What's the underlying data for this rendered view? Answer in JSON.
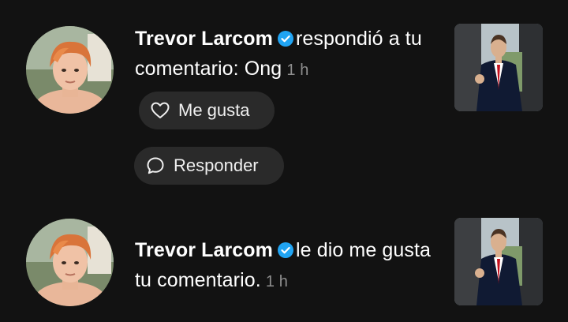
{
  "notifications": [
    {
      "username": "Trevor Larcom",
      "message": "respondió a tu comentario: Ong",
      "time": "1 h",
      "like_button": "Me gusta",
      "reply_button": "Responder",
      "avatar_icon": "user-avatar",
      "thumbnail_icon": "video-thumbnail"
    },
    {
      "username": "Trevor Larcom",
      "message": "le dio me gusta tu comentario.",
      "time": "1 h",
      "avatar_icon": "user-avatar",
      "thumbnail_icon": "video-thumbnail"
    }
  ],
  "colors": {
    "background": "#121212",
    "verified": "#20a4f3",
    "pill": "#2a2a2a",
    "time": "#8e8e8e"
  }
}
